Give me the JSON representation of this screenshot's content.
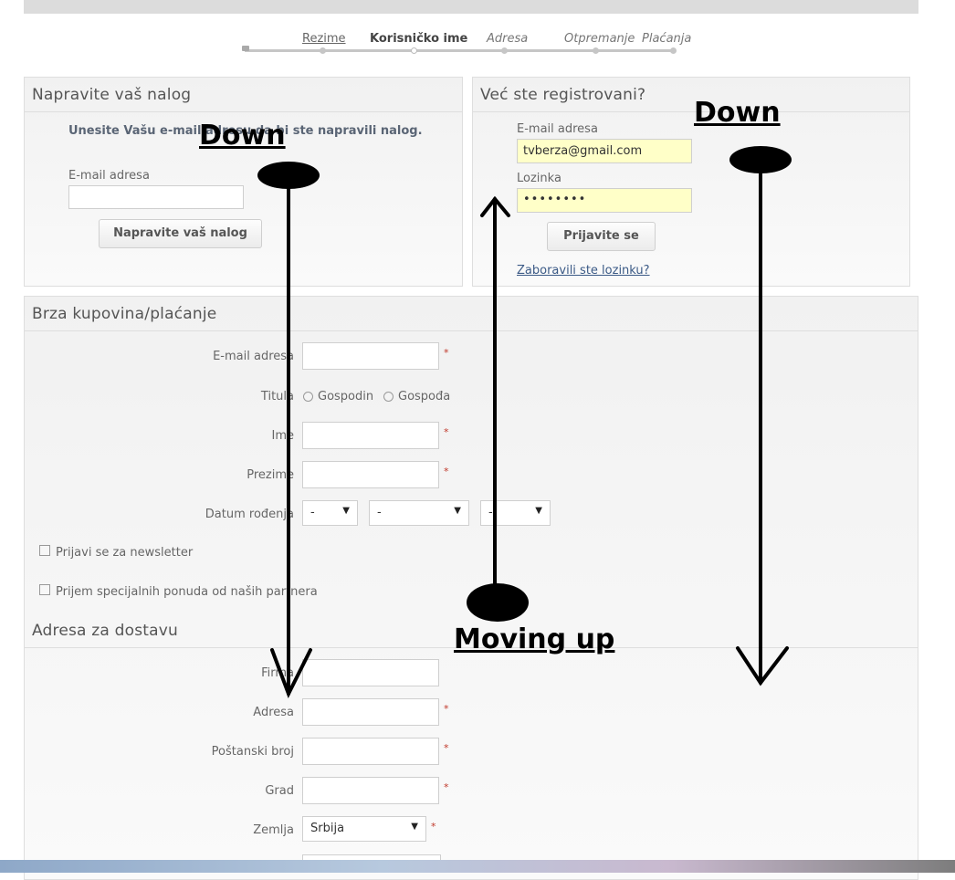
{
  "steps": [
    {
      "label": "Rezime"
    },
    {
      "label": "Korisničko ime"
    },
    {
      "label": "Adresa"
    },
    {
      "label": "Otpremanje"
    },
    {
      "label": "Plaćanja"
    }
  ],
  "create_account": {
    "title": "Napravite vaš nalog",
    "intro": "Unesite Vašu e-mail adresu da bi ste napravili nalog.",
    "email_label": "E-mail adresa",
    "email_value": "",
    "button": "Napravite vaš nalog"
  },
  "login": {
    "title": "Već ste registrovani?",
    "email_label": "E-mail adresa",
    "email_value": "tvberza@gmail.com",
    "password_label": "Lozinka",
    "password_mask": "••••••••",
    "button": "Prijavite se",
    "forgot": "Zaboravili ste lozinku?"
  },
  "quick_checkout": {
    "title": "Brza kupovina/plaćanje",
    "email_label": "E-mail adresa",
    "title_label": "Titula",
    "title_options": [
      "Gospodin",
      "Gospođa"
    ],
    "first_name_label": "Ime",
    "last_name_label": "Prezime",
    "birthdate_label": "Datum rođenja",
    "birth_day": "-",
    "birth_month": "-",
    "birth_year": "-",
    "newsletter": "Prijavi se za newsletter",
    "partner_offers": "Prijem specijalnih ponuda od naših partnera",
    "required_mark": "*"
  },
  "shipping": {
    "title": "Adresa za dostavu",
    "company_label": "Firma",
    "address_label": "Adresa",
    "postal_label": "Poštanski broj",
    "city_label": "Grad",
    "country_label": "Zemlja",
    "country_value": "Srbija"
  },
  "annotations": {
    "down_left": "Down",
    "down_right": "Down",
    "moving_up": "Moving up"
  }
}
